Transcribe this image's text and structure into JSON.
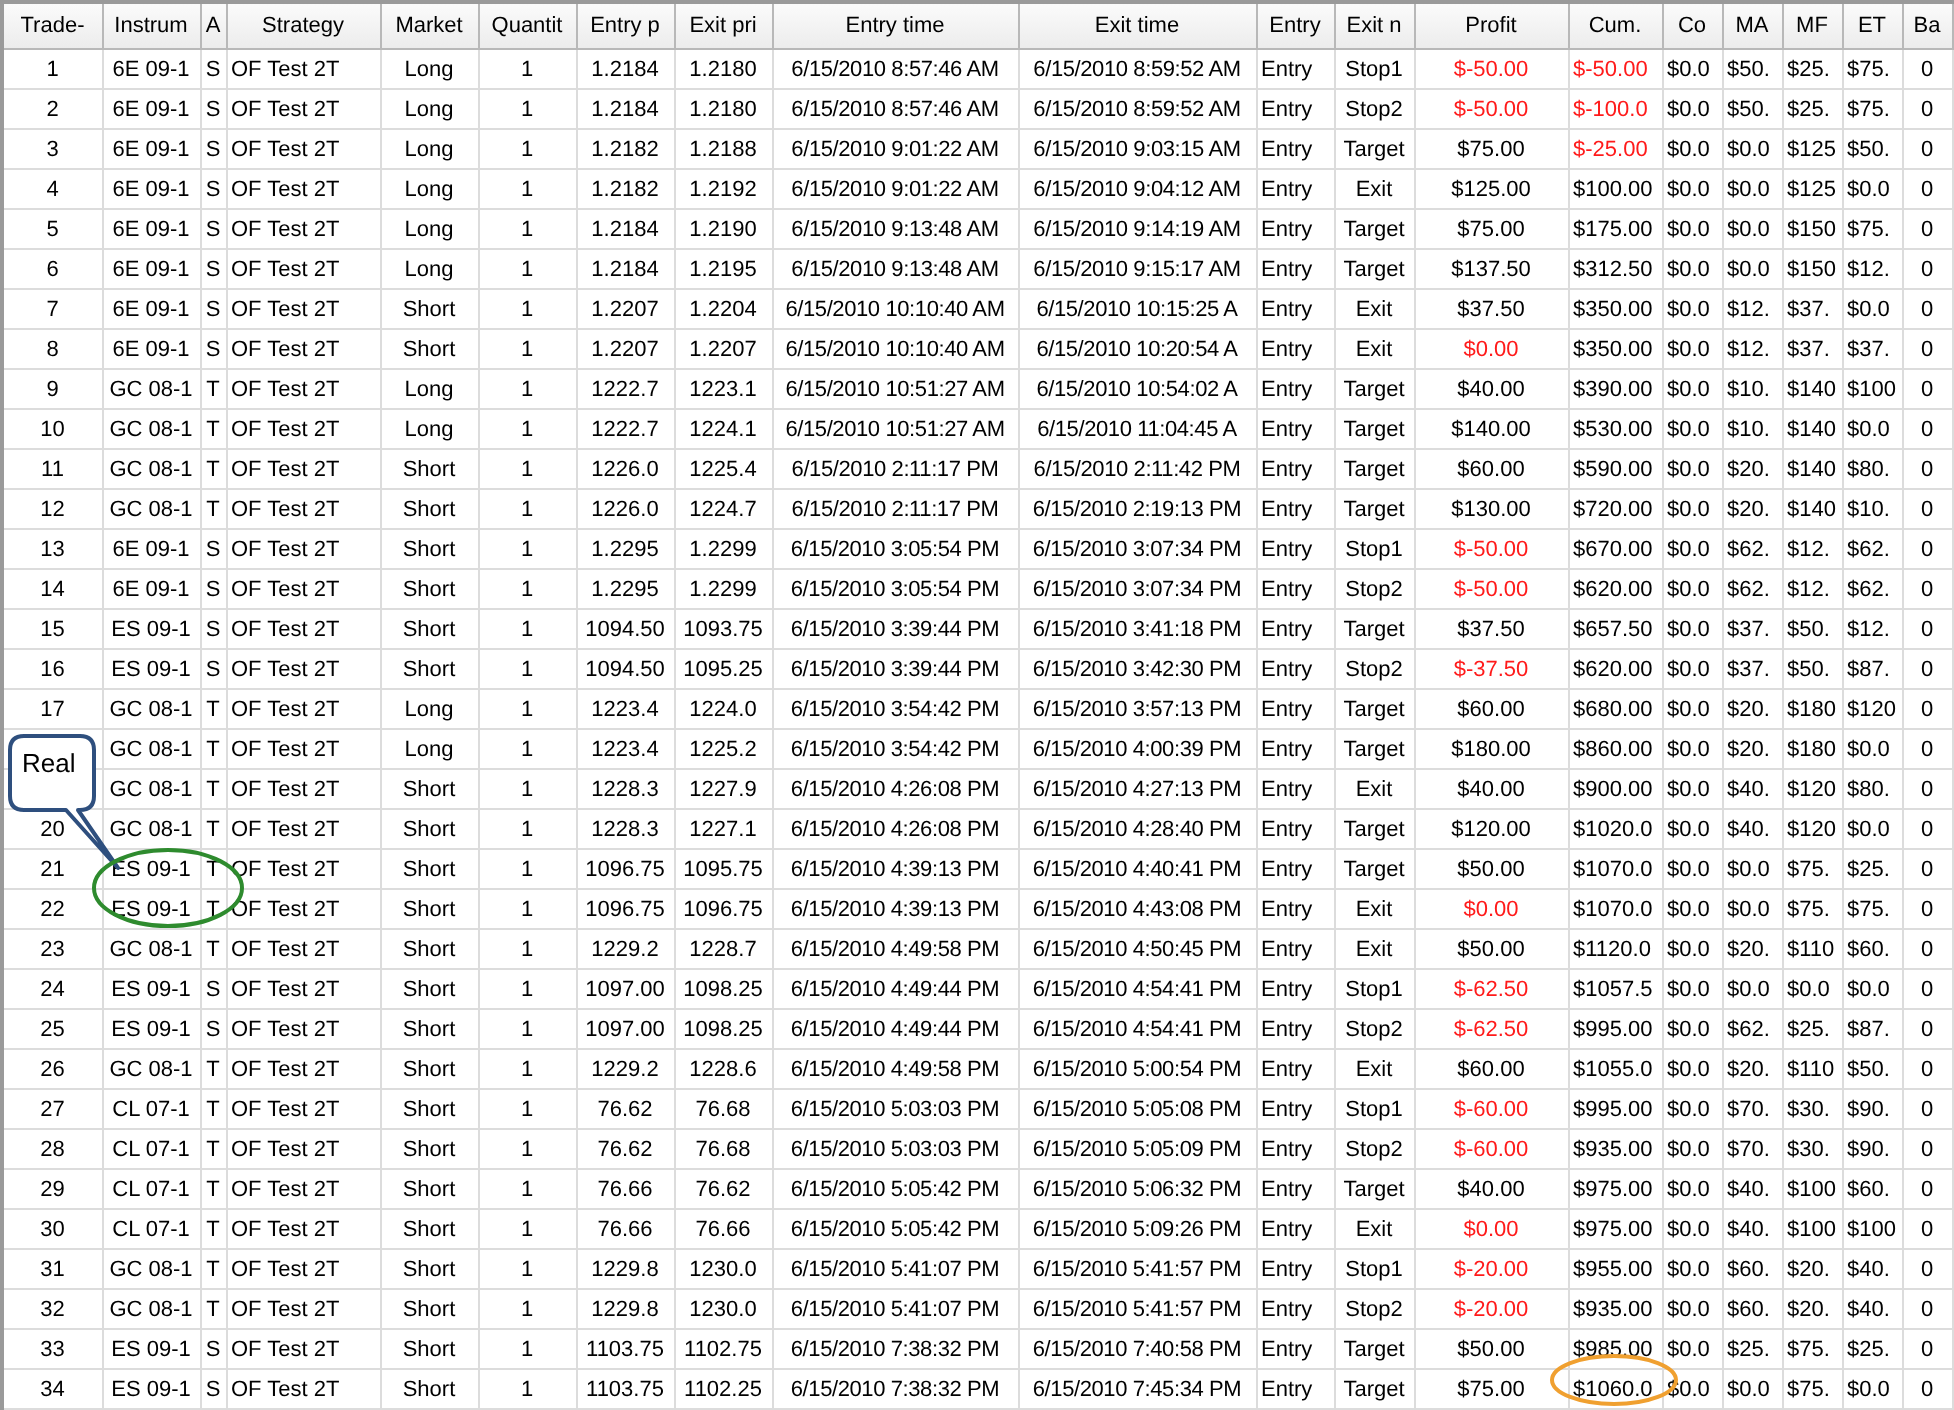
{
  "columns": [
    "Trade-",
    "Instrum",
    "A",
    "Strategy",
    "Market",
    "Quantit",
    "Entry p",
    "Exit pri",
    "Entry time",
    "Exit time",
    "Entry",
    "Exit n",
    "Profit",
    "Cum.",
    "Co",
    "MA",
    "MF",
    "ET",
    "Ba"
  ],
  "rows": [
    {
      "trade": "1",
      "cells": [
        "6E 09-1",
        "S",
        "OF Test 2T",
        "Long",
        "1",
        "1.2184",
        "1.2180",
        "6/15/2010 8:57:46 AM",
        "6/15/2010 8:59:52 AM",
        "Entry",
        "Stop1",
        "$-50.00",
        "$-50.00",
        "$0.0",
        "$50.",
        "$25.",
        "$75.",
        "0"
      ],
      "profit_loss": true,
      "cum_loss": true
    },
    {
      "trade": "2",
      "cells": [
        "6E 09-1",
        "S",
        "OF Test 2T",
        "Long",
        "1",
        "1.2184",
        "1.2180",
        "6/15/2010 8:57:46 AM",
        "6/15/2010 8:59:52 AM",
        "Entry",
        "Stop2",
        "$-50.00",
        "$-100.0",
        "$0.0",
        "$50.",
        "$25.",
        "$75.",
        "0"
      ],
      "profit_loss": true,
      "cum_loss": true
    },
    {
      "trade": "3",
      "cells": [
        "6E 09-1",
        "S",
        "OF Test 2T",
        "Long",
        "1",
        "1.2182",
        "1.2188",
        "6/15/2010 9:01:22 AM",
        "6/15/2010 9:03:15 AM",
        "Entry",
        "Target",
        "$75.00",
        "$-25.00",
        "$0.0",
        "$0.0",
        "$125",
        "$50.",
        "0"
      ],
      "profit_loss": false,
      "cum_loss": true
    },
    {
      "trade": "4",
      "cells": [
        "6E 09-1",
        "S",
        "OF Test 2T",
        "Long",
        "1",
        "1.2182",
        "1.2192",
        "6/15/2010 9:01:22 AM",
        "6/15/2010 9:04:12 AM",
        "Entry",
        "Exit",
        "$125.00",
        "$100.00",
        "$0.0",
        "$0.0",
        "$125",
        "$0.0",
        "0"
      ],
      "profit_loss": false,
      "cum_loss": false
    },
    {
      "trade": "5",
      "cells": [
        "6E 09-1",
        "S",
        "OF Test 2T",
        "Long",
        "1",
        "1.2184",
        "1.2190",
        "6/15/2010 9:13:48 AM",
        "6/15/2010 9:14:19 AM",
        "Entry",
        "Target",
        "$75.00",
        "$175.00",
        "$0.0",
        "$0.0",
        "$150",
        "$75.",
        "0"
      ],
      "profit_loss": false,
      "cum_loss": false
    },
    {
      "trade": "6",
      "cells": [
        "6E 09-1",
        "S",
        "OF Test 2T",
        "Long",
        "1",
        "1.2184",
        "1.2195",
        "6/15/2010 9:13:48 AM",
        "6/15/2010 9:15:17 AM",
        "Entry",
        "Target",
        "$137.50",
        "$312.50",
        "$0.0",
        "$0.0",
        "$150",
        "$12.",
        "0"
      ],
      "profit_loss": false,
      "cum_loss": false
    },
    {
      "trade": "7",
      "cells": [
        "6E 09-1",
        "S",
        "OF Test 2T",
        "Short",
        "1",
        "1.2207",
        "1.2204",
        "6/15/2010 10:10:40 AM",
        "6/15/2010 10:15:25 A",
        "Entry",
        "Exit",
        "$37.50",
        "$350.00",
        "$0.0",
        "$12.",
        "$37.",
        "$0.0",
        "0"
      ],
      "profit_loss": false,
      "cum_loss": false
    },
    {
      "trade": "8",
      "cells": [
        "6E 09-1",
        "S",
        "OF Test 2T",
        "Short",
        "1",
        "1.2207",
        "1.2207",
        "6/15/2010 10:10:40 AM",
        "6/15/2010 10:20:54 A",
        "Entry",
        "Exit",
        "$0.00",
        "$350.00",
        "$0.0",
        "$12.",
        "$37.",
        "$37.",
        "0"
      ],
      "profit_loss": true,
      "cum_loss": false
    },
    {
      "trade": "9",
      "cells": [
        "GC 08-1",
        "T",
        "OF Test 2T",
        "Long",
        "1",
        "1222.7",
        "1223.1",
        "6/15/2010 10:51:27 AM",
        "6/15/2010 10:54:02 A",
        "Entry",
        "Target",
        "$40.00",
        "$390.00",
        "$0.0",
        "$10.",
        "$140",
        "$100",
        "0"
      ],
      "profit_loss": false,
      "cum_loss": false
    },
    {
      "trade": "10",
      "cells": [
        "GC 08-1",
        "T",
        "OF Test 2T",
        "Long",
        "1",
        "1222.7",
        "1224.1",
        "6/15/2010 10:51:27 AM",
        "6/15/2010 11:04:45 A",
        "Entry",
        "Target",
        "$140.00",
        "$530.00",
        "$0.0",
        "$10.",
        "$140",
        "$0.0",
        "0"
      ],
      "profit_loss": false,
      "cum_loss": false
    },
    {
      "trade": "11",
      "cells": [
        "GC 08-1",
        "T",
        "OF Test 2T",
        "Short",
        "1",
        "1226.0",
        "1225.4",
        "6/15/2010 2:11:17 PM",
        "6/15/2010 2:11:42 PM",
        "Entry",
        "Target",
        "$60.00",
        "$590.00",
        "$0.0",
        "$20.",
        "$140",
        "$80.",
        "0"
      ],
      "profit_loss": false,
      "cum_loss": false
    },
    {
      "trade": "12",
      "cells": [
        "GC 08-1",
        "T",
        "OF Test 2T",
        "Short",
        "1",
        "1226.0",
        "1224.7",
        "6/15/2010 2:11:17 PM",
        "6/15/2010 2:19:13 PM",
        "Entry",
        "Target",
        "$130.00",
        "$720.00",
        "$0.0",
        "$20.",
        "$140",
        "$10.",
        "0"
      ],
      "profit_loss": false,
      "cum_loss": false
    },
    {
      "trade": "13",
      "cells": [
        "6E 09-1",
        "S",
        "OF Test 2T",
        "Short",
        "1",
        "1.2295",
        "1.2299",
        "6/15/2010 3:05:54 PM",
        "6/15/2010 3:07:34 PM",
        "Entry",
        "Stop1",
        "$-50.00",
        "$670.00",
        "$0.0",
        "$62.",
        "$12.",
        "$62.",
        "0"
      ],
      "profit_loss": true,
      "cum_loss": false
    },
    {
      "trade": "14",
      "cells": [
        "6E 09-1",
        "S",
        "OF Test 2T",
        "Short",
        "1",
        "1.2295",
        "1.2299",
        "6/15/2010 3:05:54 PM",
        "6/15/2010 3:07:34 PM",
        "Entry",
        "Stop2",
        "$-50.00",
        "$620.00",
        "$0.0",
        "$62.",
        "$12.",
        "$62.",
        "0"
      ],
      "profit_loss": true,
      "cum_loss": false
    },
    {
      "trade": "15",
      "cells": [
        "ES 09-1",
        "S",
        "OF Test 2T",
        "Short",
        "1",
        "1094.50",
        "1093.75",
        "6/15/2010 3:39:44 PM",
        "6/15/2010 3:41:18 PM",
        "Entry",
        "Target",
        "$37.50",
        "$657.50",
        "$0.0",
        "$37.",
        "$50.",
        "$12.",
        "0"
      ],
      "profit_loss": false,
      "cum_loss": false
    },
    {
      "trade": "16",
      "cells": [
        "ES 09-1",
        "S",
        "OF Test 2T",
        "Short",
        "1",
        "1094.50",
        "1095.25",
        "6/15/2010 3:39:44 PM",
        "6/15/2010 3:42:30 PM",
        "Entry",
        "Stop2",
        "$-37.50",
        "$620.00",
        "$0.0",
        "$37.",
        "$50.",
        "$87.",
        "0"
      ],
      "profit_loss": true,
      "cum_loss": false
    },
    {
      "trade": "17",
      "cells": [
        "GC 08-1",
        "T",
        "OF Test 2T",
        "Long",
        "1",
        "1223.4",
        "1224.0",
        "6/15/2010 3:54:42 PM",
        "6/15/2010 3:57:13 PM",
        "Entry",
        "Target",
        "$60.00",
        "$680.00",
        "$0.0",
        "$20.",
        "$180",
        "$120",
        "0"
      ],
      "profit_loss": false,
      "cum_loss": false
    },
    {
      "cells": [
        "GC 08-1",
        "T",
        "OF Test 2T",
        "Long",
        "1",
        "1223.4",
        "1225.2",
        "6/15/2010 3:54:42 PM",
        "6/15/2010 4:00:39 PM",
        "Entry",
        "Target",
        "$180.00",
        "$860.00",
        "$0.0",
        "$20.",
        "$180",
        "$0.0",
        "0"
      ],
      "profit_loss": false,
      "cum_loss": false
    },
    {
      "cells": [
        "GC 08-1",
        "T",
        "OF Test 2T",
        "Short",
        "1",
        "1228.3",
        "1227.9",
        "6/15/2010 4:26:08 PM",
        "6/15/2010 4:27:13 PM",
        "Entry",
        "Exit",
        "$40.00",
        "$900.00",
        "$0.0",
        "$40.",
        "$120",
        "$80.",
        "0"
      ],
      "profit_loss": false,
      "cum_loss": false
    },
    {
      "trade": "20",
      "cells": [
        "GC 08-1",
        "T",
        "OF Test 2T",
        "Short",
        "1",
        "1228.3",
        "1227.1",
        "6/15/2010 4:26:08 PM",
        "6/15/2010 4:28:40 PM",
        "Entry",
        "Target",
        "$120.00",
        "$1020.0",
        "$0.0",
        "$40.",
        "$120",
        "$0.0",
        "0"
      ],
      "profit_loss": false,
      "cum_loss": false
    },
    {
      "trade": "21",
      "cells": [
        "ES 09-1",
        "T",
        "OF Test 2T",
        "Short",
        "1",
        "1096.75",
        "1095.75",
        "6/15/2010 4:39:13 PM",
        "6/15/2010 4:40:41 PM",
        "Entry",
        "Target",
        "$50.00",
        "$1070.0",
        "$0.0",
        "$0.0",
        "$75.",
        "$25.",
        "0"
      ],
      "profit_loss": false,
      "cum_loss": false
    },
    {
      "trade": "22",
      "cells": [
        "ES 09-1",
        "T",
        "OF Test 2T",
        "Short",
        "1",
        "1096.75",
        "1096.75",
        "6/15/2010 4:39:13 PM",
        "6/15/2010 4:43:08 PM",
        "Entry",
        "Exit",
        "$0.00",
        "$1070.0",
        "$0.0",
        "$0.0",
        "$75.",
        "$75.",
        "0"
      ],
      "profit_loss": true,
      "cum_loss": false
    },
    {
      "trade": "23",
      "cells": [
        "GC 08-1",
        "T",
        "OF Test 2T",
        "Short",
        "1",
        "1229.2",
        "1228.7",
        "6/15/2010 4:49:58 PM",
        "6/15/2010 4:50:45 PM",
        "Entry",
        "Exit",
        "$50.00",
        "$1120.0",
        "$0.0",
        "$20.",
        "$110",
        "$60.",
        "0"
      ],
      "profit_loss": false,
      "cum_loss": false
    },
    {
      "trade": "24",
      "cells": [
        "ES 09-1",
        "S",
        "OF Test 2T",
        "Short",
        "1",
        "1097.00",
        "1098.25",
        "6/15/2010 4:49:44 PM",
        "6/15/2010 4:54:41 PM",
        "Entry",
        "Stop1",
        "$-62.50",
        "$1057.5",
        "$0.0",
        "$0.0",
        "$0.0",
        "$0.0",
        "0"
      ],
      "profit_loss": true,
      "cum_loss": false
    },
    {
      "trade": "25",
      "cells": [
        "ES 09-1",
        "S",
        "OF Test 2T",
        "Short",
        "1",
        "1097.00",
        "1098.25",
        "6/15/2010 4:49:44 PM",
        "6/15/2010 4:54:41 PM",
        "Entry",
        "Stop2",
        "$-62.50",
        "$995.00",
        "$0.0",
        "$62.",
        "$25.",
        "$87.",
        "0"
      ],
      "profit_loss": true,
      "cum_loss": false
    },
    {
      "trade": "26",
      "cells": [
        "GC 08-1",
        "T",
        "OF Test 2T",
        "Short",
        "1",
        "1229.2",
        "1228.6",
        "6/15/2010 4:49:58 PM",
        "6/15/2010 5:00:54 PM",
        "Entry",
        "Exit",
        "$60.00",
        "$1055.0",
        "$0.0",
        "$20.",
        "$110",
        "$50.",
        "0"
      ],
      "profit_loss": false,
      "cum_loss": false
    },
    {
      "trade": "27",
      "cells": [
        "CL 07-1",
        "T",
        "OF Test 2T",
        "Short",
        "1",
        "76.62",
        "76.68",
        "6/15/2010 5:03:03 PM",
        "6/15/2010 5:05:08 PM",
        "Entry",
        "Stop1",
        "$-60.00",
        "$995.00",
        "$0.0",
        "$70.",
        "$30.",
        "$90.",
        "0"
      ],
      "profit_loss": true,
      "cum_loss": false
    },
    {
      "trade": "28",
      "cells": [
        "CL 07-1",
        "T",
        "OF Test 2T",
        "Short",
        "1",
        "76.62",
        "76.68",
        "6/15/2010 5:03:03 PM",
        "6/15/2010 5:05:09 PM",
        "Entry",
        "Stop2",
        "$-60.00",
        "$935.00",
        "$0.0",
        "$70.",
        "$30.",
        "$90.",
        "0"
      ],
      "profit_loss": true,
      "cum_loss": false
    },
    {
      "trade": "29",
      "cells": [
        "CL 07-1",
        "T",
        "OF Test 2T",
        "Short",
        "1",
        "76.66",
        "76.62",
        "6/15/2010 5:05:42 PM",
        "6/15/2010 5:06:32 PM",
        "Entry",
        "Target",
        "$40.00",
        "$975.00",
        "$0.0",
        "$40.",
        "$100",
        "$60.",
        "0"
      ],
      "profit_loss": false,
      "cum_loss": false
    },
    {
      "trade": "30",
      "cells": [
        "CL 07-1",
        "T",
        "OF Test 2T",
        "Short",
        "1",
        "76.66",
        "76.66",
        "6/15/2010 5:05:42 PM",
        "6/15/2010 5:09:26 PM",
        "Entry",
        "Exit",
        "$0.00",
        "$975.00",
        "$0.0",
        "$40.",
        "$100",
        "$100",
        "0"
      ],
      "profit_loss": true,
      "cum_loss": false
    },
    {
      "trade": "31",
      "cells": [
        "GC 08-1",
        "T",
        "OF Test 2T",
        "Short",
        "1",
        "1229.8",
        "1230.0",
        "6/15/2010 5:41:07 PM",
        "6/15/2010 5:41:57 PM",
        "Entry",
        "Stop1",
        "$-20.00",
        "$955.00",
        "$0.0",
        "$60.",
        "$20.",
        "$40.",
        "0"
      ],
      "profit_loss": true,
      "cum_loss": false
    },
    {
      "trade": "32",
      "cells": [
        "GC 08-1",
        "T",
        "OF Test 2T",
        "Short",
        "1",
        "1229.8",
        "1230.0",
        "6/15/2010 5:41:07 PM",
        "6/15/2010 5:41:57 PM",
        "Entry",
        "Stop2",
        "$-20.00",
        "$935.00",
        "$0.0",
        "$60.",
        "$20.",
        "$40.",
        "0"
      ],
      "profit_loss": true,
      "cum_loss": false
    },
    {
      "trade": "33",
      "cells": [
        "ES 09-1",
        "S",
        "OF Test 2T",
        "Short",
        "1",
        "1103.75",
        "1102.75",
        "6/15/2010 7:38:32 PM",
        "6/15/2010 7:40:58 PM",
        "Entry",
        "Target",
        "$50.00",
        "$985.00",
        "$0.0",
        "$25.",
        "$75.",
        "$25.",
        "0"
      ],
      "profit_loss": false,
      "cum_loss": false
    },
    {
      "trade": "34",
      "cells": [
        "ES 09-1",
        "S",
        "OF Test 2T",
        "Short",
        "1",
        "1103.75",
        "1102.25",
        "6/15/2010 7:38:32 PM",
        "6/15/2010 7:45:34 PM",
        "Entry",
        "Target",
        "$75.00",
        "$1060.0",
        "$0.0",
        "$0.0",
        "$75.",
        "$0.0",
        "0"
      ],
      "profit_loss": false,
      "cum_loss": false
    }
  ],
  "callout": {
    "text": "Real"
  }
}
